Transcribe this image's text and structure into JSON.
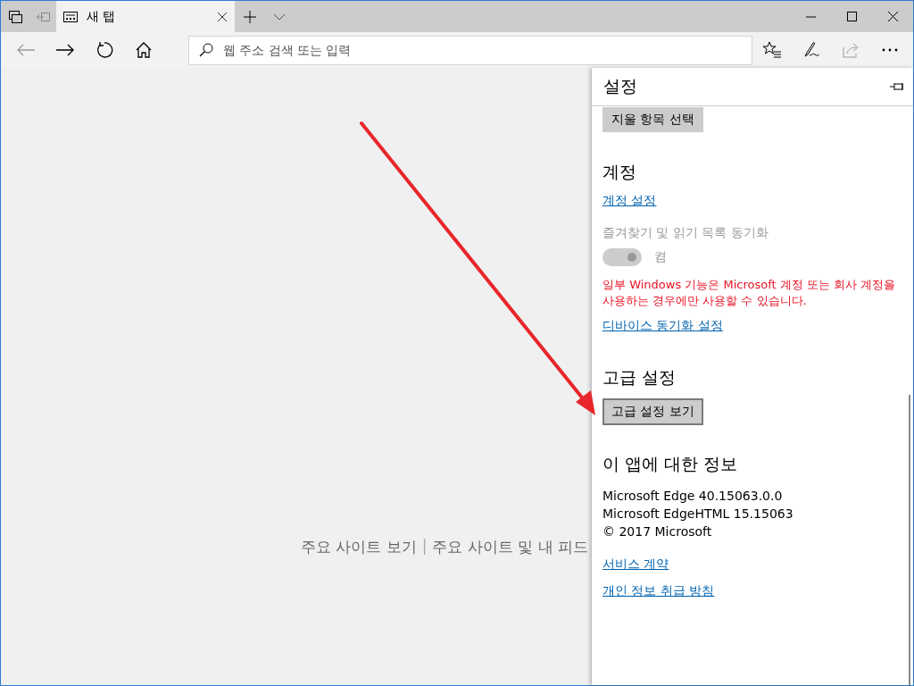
{
  "tabs": [
    {
      "title": "새 탭",
      "selected": true
    }
  ],
  "address_bar": {
    "placeholder": "웹 주소 검색 또는 입력"
  },
  "new_tab_page": {
    "links": [
      "주요 사이트 보기",
      "주요 사이트 및 내 피드"
    ],
    "separator": "|"
  },
  "settings": {
    "title": "설정",
    "clear_button": "지울 항목 선택",
    "account": {
      "heading": "계정",
      "link": "계정 설정",
      "sync_label": "즐겨찾기 및 읽기 목록 동기화",
      "sync_toggle": {
        "on": true,
        "disabled": true,
        "label": "켬"
      },
      "warning": "일부 Windows 기능은 Microsoft 계정 또는 회사 계정을 사용하는 경우에만 사용할 수 있습니다.",
      "device_link": "디바이스 동기화 설정"
    },
    "advanced": {
      "heading": "고급 설정",
      "button": "고급 설정 보기"
    },
    "about": {
      "heading": "이 앱에 대한 정보",
      "lines": [
        "Microsoft Edge 40.15063.0.0",
        "Microsoft EdgeHTML 15.15063",
        "© 2017 Microsoft"
      ],
      "links": [
        "서비스 계약",
        "개인 정보 취급 방침"
      ]
    }
  }
}
